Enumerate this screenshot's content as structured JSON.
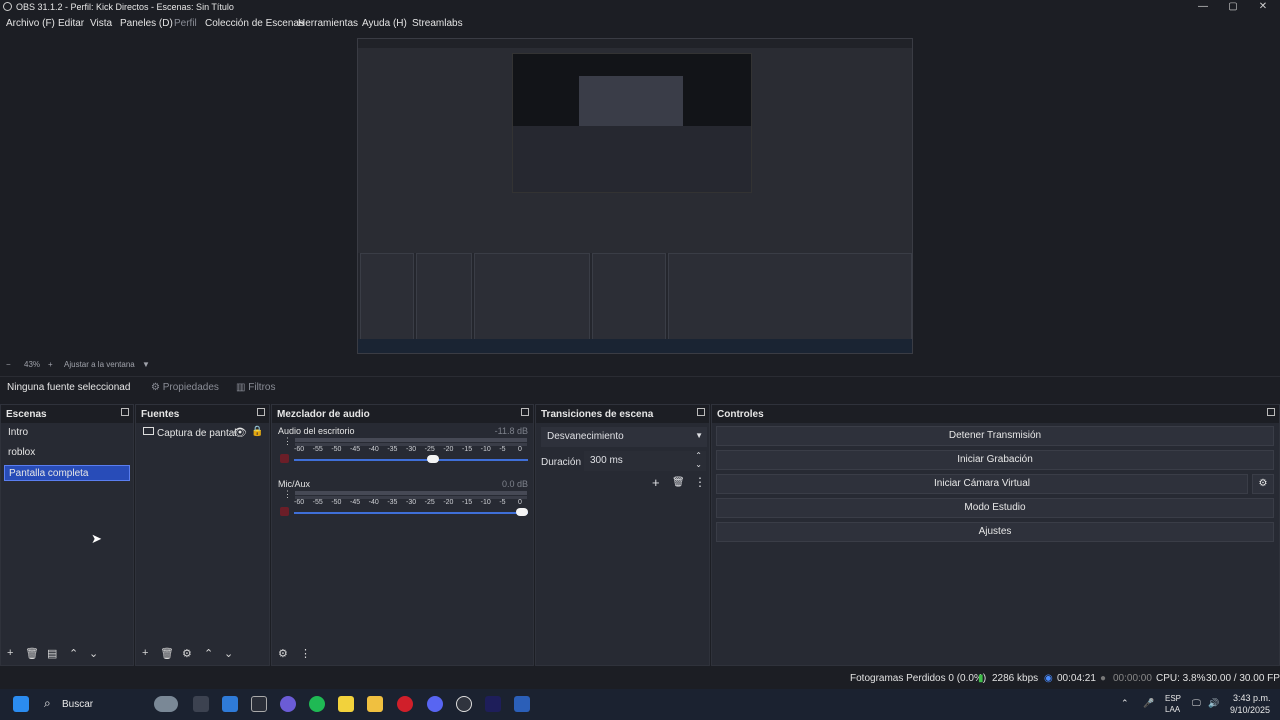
{
  "window": {
    "title": "OBS 31.1.2 - Perfil: Kick Directos - Escenas: Sin Título"
  },
  "menu": [
    "Archivo (F)",
    "Editar",
    "Vista",
    "Paneles (D)",
    "Perfil",
    "Colección de Escenas",
    "Herramientas",
    "Ayuda (H)",
    "Streamlabs"
  ],
  "zoom": {
    "minus": "−",
    "value": "43%",
    "plus": "+",
    "fit": "Ajustar a la ventana"
  },
  "source_toolbar": {
    "none_selected": "Ninguna fuente seleccionad",
    "properties": "Propiedades",
    "filters": "Filtros"
  },
  "scenes": {
    "title": "Escenas",
    "items": [
      "Intro",
      "roblox",
      "Pantalla completa"
    ],
    "selected": "Pantalla completa"
  },
  "sources": {
    "title": "Fuentes",
    "items": [
      {
        "label": "Captura de pantal"
      }
    ]
  },
  "mixer": {
    "title": "Mezclador de audio",
    "channels": [
      {
        "name": "Audio del escritorio",
        "db": "-11.8 dB",
        "volume": 0.6
      },
      {
        "name": "Mic/Aux",
        "db": "0.0 dB",
        "volume": 1.0
      }
    ],
    "ticks": [
      "-60",
      "-55",
      "-50",
      "-45",
      "-40",
      "-35",
      "-30",
      "-25",
      "-20",
      "-15",
      "-10",
      "-5",
      "0"
    ]
  },
  "transitions": {
    "title": "Transiciones de escena",
    "selected": "Desvanecimiento",
    "duration_label": "Duración",
    "duration_value": "300 ms"
  },
  "controls": {
    "title": "Controles",
    "buttons": [
      "Detener Transmisión",
      "Iniciar Grabación",
      "Iniciar Cámara Virtual",
      "Modo Estudio",
      "Ajustes"
    ]
  },
  "status": {
    "dropped": "Fotogramas Perdidos 0 (0.0%)",
    "bitrate": "2286 kbps",
    "stream_time": "00:04:21",
    "rec_time": "00:00:00",
    "cpu": "CPU: 3.8%",
    "fps": "30.00 / 30.00 FPS"
  },
  "taskbar": {
    "search": "Buscar",
    "lang1": "ESP",
    "lang2": "LAA",
    "time": "3:43 p.m.",
    "date": "9/10/2025"
  },
  "colors": {
    "accent": "#284cb8",
    "slider": "#3f6fd8",
    "mute": "#6b1e28",
    "bg": "#1c1e24",
    "dock": "#272a33"
  },
  "icons": [
    "windows-start-icon",
    "search-icon",
    "gear-icon",
    "eye-icon",
    "lock-icon",
    "plus-icon",
    "trash-icon",
    "up-icon",
    "down-icon",
    "dots-icon"
  ]
}
